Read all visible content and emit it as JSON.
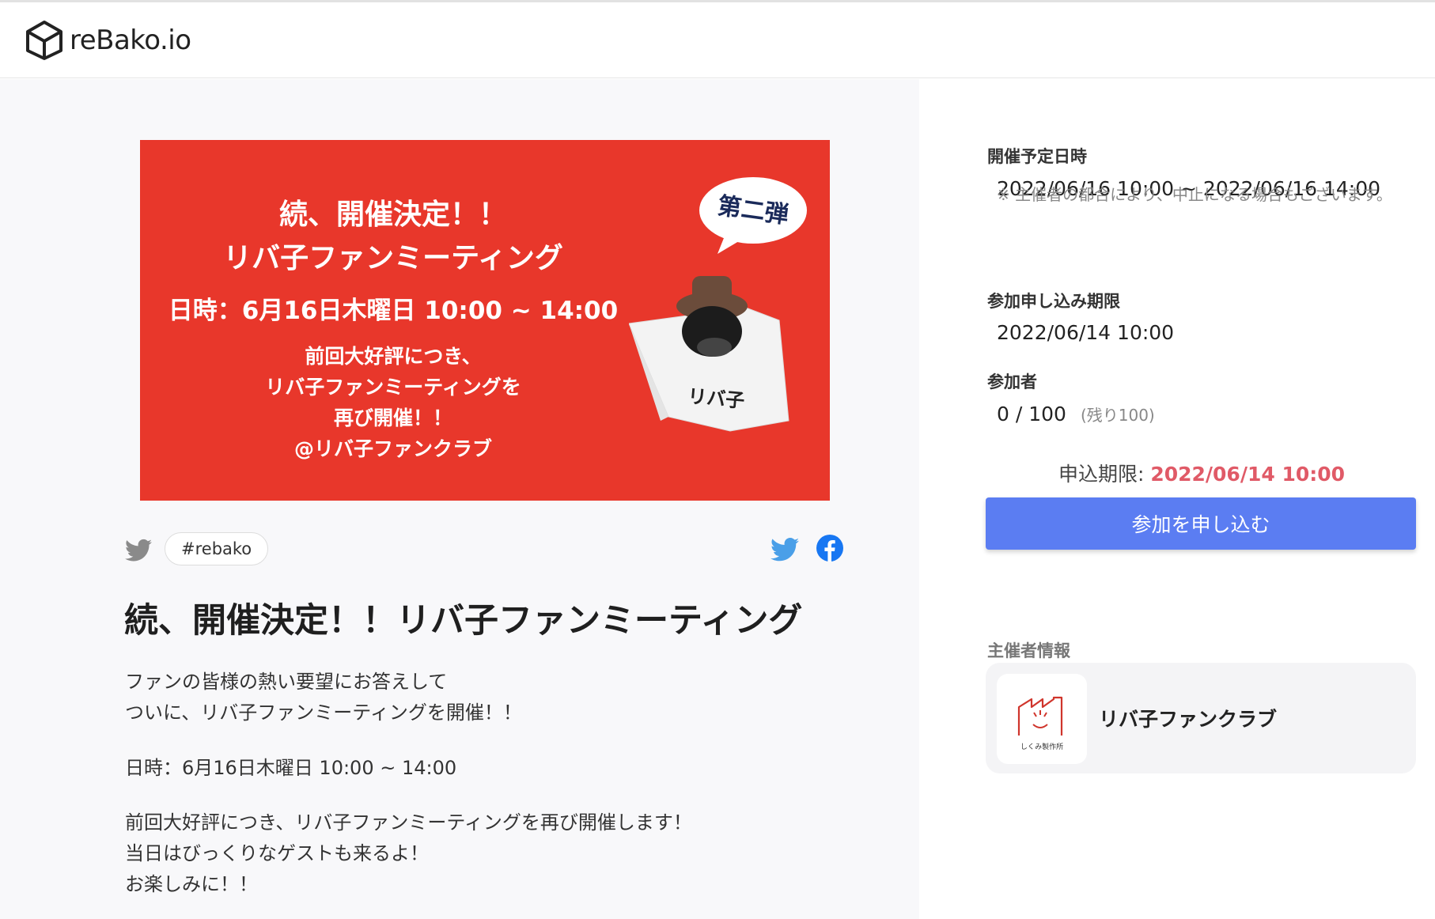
{
  "header": {
    "logo_text": "reBako.io"
  },
  "banner": {
    "title_line1": "続、開催決定！！",
    "title_line2": "リバ子ファンミーティング",
    "date_line": "日時：6月16日木曜日 10:00 ~ 14:00",
    "desc_lines": [
      "前回大好評につき、",
      "リバ子ファンミーティングを",
      "再び開催！！",
      "@リバ子ファンクラブ"
    ],
    "badge_text": "第二弾",
    "box_label": "リバ子",
    "background_color": "#e8372b"
  },
  "share": {
    "hashtag": "#rebako"
  },
  "event": {
    "title": "続、開催決定！！リバ子ファンミーティング",
    "description": [
      "ファンの皆様の熱い要望にお答えして",
      "ついに、リバ子ファンミーティングを開催！！",
      "日時：6月16日木曜日 10:00 ~ 14:00",
      "前回大好評につき、リバ子ファンミーティングを再び開催します！",
      "当日はびっくりなゲストも来るよ！",
      "お楽しみに！！"
    ]
  },
  "sidebar": {
    "schedule_label": "開催予定日時",
    "schedule_value": "2022/06/16 10:00 ~ 2022/06/16 14:00",
    "schedule_note": "※ 主催者の都合により、中止になる場合もございます。",
    "deadline_label": "参加申し込み期限",
    "deadline_value": "2022/06/14 10:00",
    "participants_label": "参加者",
    "participants_value": "0 / 100",
    "participants_remaining": "(残り100)",
    "apply_deadline_label": "申込期限: ",
    "apply_deadline_value": "2022/06/14 10:00",
    "apply_button": "参加を申し込む",
    "organizer_label": "主催者情報",
    "organizer_name": "リバ子ファンクラブ",
    "organizer_logo_text": "しくみ製作所"
  },
  "colors": {
    "accent": "#5b7df2",
    "deadline": "#e05a67",
    "twitter": "#4a9fe8",
    "facebook": "#1877f2"
  }
}
